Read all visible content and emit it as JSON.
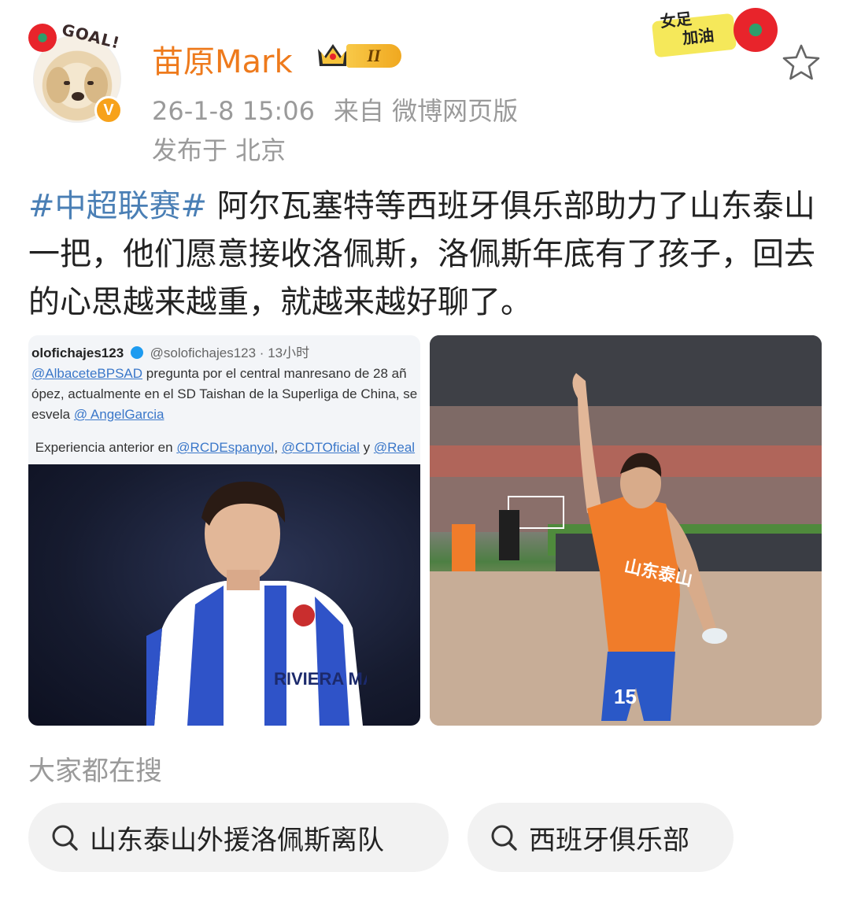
{
  "header": {
    "username": "苗原Mark",
    "level_badge": "II",
    "avatar_sticker_text": "GOAL!",
    "verified_mark": "V",
    "timestamp": "26-1-8 15:06",
    "source": "来自 微博网页版",
    "location": "发布于 北京",
    "corner_sticker_lines": [
      "女足",
      "加油"
    ]
  },
  "post": {
    "hashtag": "#中超联赛#",
    "text": " 阿尔瓦塞特等西班牙俱乐部助力了山东泰山一把，他们愿意接收洛佩斯，洛佩斯年底有了孩子，回去的心思越来越重，就越来越好聊了。"
  },
  "embedded_tweet": {
    "account": "olofichajes123",
    "handle": "@solofichajes123 · 13小时",
    "line1_link": "@AlbaceteBPSAD",
    "line1_text": " pregunta por el central manresano de 28 añ",
    "line2": "ópez, actualmente en el SD Taishan de la Superliga de China, se",
    "line3_prefix": "esvela ",
    "line3_link": "@ AngelGarcia",
    "line4_prefix": "Experiencia anterior en ",
    "line4_link1": "@RCDEspanyol",
    "line4_sep": ", ",
    "line4_link2": "@CDTOficial",
    "line4_and": " y ",
    "line4_link3": "@Real"
  },
  "photo_texts": {
    "left_sponsor": "RIVIERA MAYA",
    "right_shirt_text": "山东泰山",
    "right_number": "15"
  },
  "search": {
    "title": "大家都在搜",
    "chips": [
      "山东泰山外援洛佩斯离队",
      "西班牙俱乐部"
    ]
  },
  "colors": {
    "username": "#ee7a1c",
    "hashtag": "#4a7fb5",
    "meta": "#9a9a9a",
    "chip_bg": "#f2f2f2"
  },
  "icons": [
    "verified-v-icon",
    "crown-level-icon",
    "star-favorite-icon",
    "search-icon"
  ]
}
